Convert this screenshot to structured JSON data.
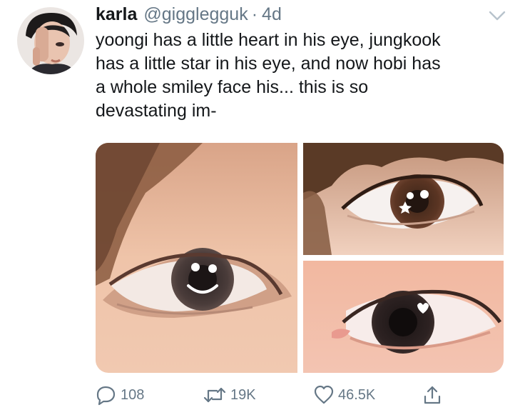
{
  "tweet": {
    "author": {
      "display_name": "karla",
      "handle": "@giggleggu​k",
      "separator": "·",
      "timestamp": "4d"
    },
    "text": "yoongi has a little heart in his eye, jungkook\nhas a little star in his eye, and now hobi has\na whole smiley face his... this is so\ndevastating im-",
    "actions": {
      "replies": "108",
      "retweets": "19K",
      "likes": "46.5K"
    }
  },
  "colors": {
    "text_primary": "#14171a",
    "text_secondary": "#657786",
    "icon": "#657786"
  },
  "icons": {
    "caret": "chevron-down-icon",
    "reply": "reply-icon",
    "retweet": "retweet-icon",
    "like": "heart-icon",
    "share": "share-icon"
  }
}
